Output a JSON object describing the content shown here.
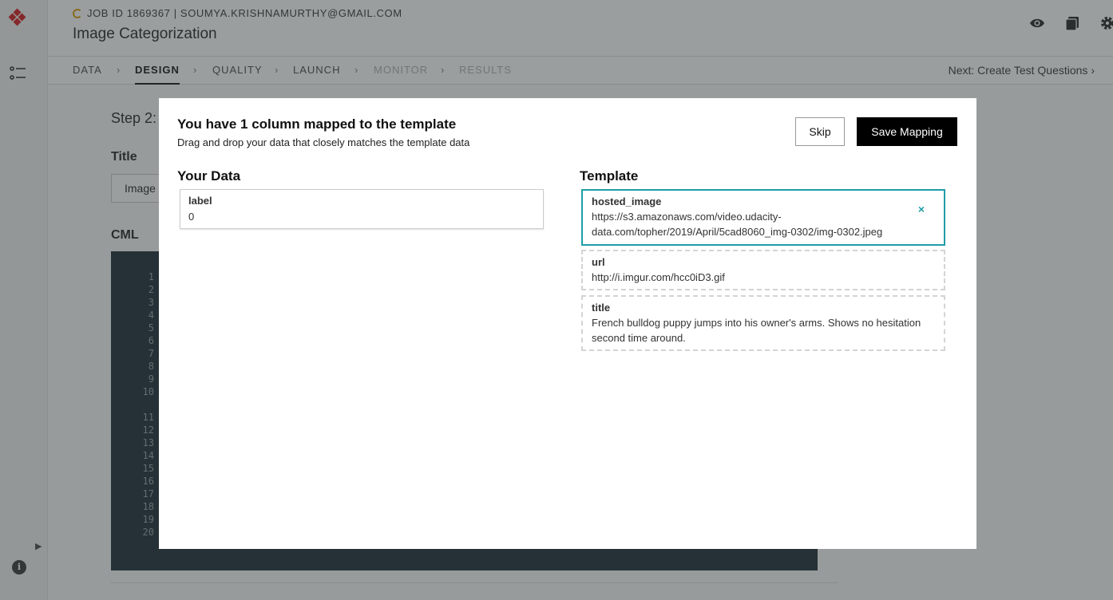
{
  "header": {
    "job_line": "JOB ID 1869367 | SOUMYA.KRISHNAMURTHY@GMAIL.COM",
    "title": "Image Categorization",
    "icons": [
      "eye-icon",
      "copy-icon",
      "gear-icon"
    ]
  },
  "tabs": [
    {
      "label": "DATA",
      "state": "normal"
    },
    {
      "label": "DESIGN",
      "state": "active"
    },
    {
      "label": "QUALITY",
      "state": "normal"
    },
    {
      "label": "LAUNCH",
      "state": "normal"
    },
    {
      "label": "MONITOR",
      "state": "disabled"
    },
    {
      "label": "RESULTS",
      "state": "disabled"
    }
  ],
  "next_link": "Next: Create Test Questions",
  "main": {
    "step_title": "Step 2:",
    "title_label": "Title",
    "title_value": "Image",
    "cml_label": "CML",
    "line_numbers": [
      "1",
      "2",
      "3",
      "4",
      "5",
      "6",
      "7",
      "8",
      "9",
      "10",
      "",
      "11",
      "12",
      "13",
      "14",
      "15",
      "16",
      "17",
      "18",
      "19",
      "20"
    ]
  },
  "modal": {
    "title": "You have 1 column mapped to the template",
    "subtitle": "Drag and drop your data that closely matches the template data",
    "skip_label": "Skip",
    "save_label": "Save Mapping",
    "your_data_heading": "Your Data",
    "template_heading": "Template",
    "your_data": [
      {
        "key": "label",
        "value": "0"
      }
    ],
    "template": [
      {
        "key": "hosted_image",
        "value": "https://s3.amazonaws.com/video.udacity-data.com/topher/2019/April/5cad8060_img-0302/img-0302.jpeg",
        "mapped": true
      },
      {
        "key": "url",
        "value": "http://i.imgur.com/hcc0iD3.gif",
        "mapped": false
      },
      {
        "key": "title",
        "value": "French bulldog puppy jumps into his owner's arms. Shows no hesitation second time around.",
        "mapped": false
      }
    ],
    "remove_symbol": "×"
  },
  "colors": {
    "accent": "#1f9ea8",
    "logo": "#d9282f",
    "primary_button": "#000000"
  }
}
